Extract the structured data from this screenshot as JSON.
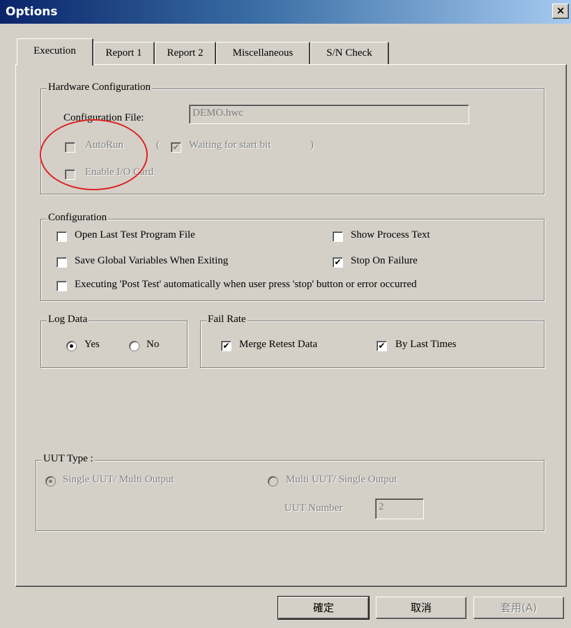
{
  "window": {
    "title": "Options",
    "close_label": "×"
  },
  "tabs": [
    {
      "label": "Execution",
      "active": true
    },
    {
      "label": "Report 1"
    },
    {
      "label": "Report 2"
    },
    {
      "label": "Miscellaneous"
    },
    {
      "label": "S/N Check"
    }
  ],
  "hardware": {
    "legend": "Hardware Configuration",
    "config_file_label": "Configuration File:",
    "config_file_value": "DEMO.hwc",
    "autorun_label": "AutoRun",
    "autorun_checked": false,
    "paren_open": "(",
    "waiting_label": "Waiting for start bit",
    "waiting_checked": true,
    "paren_close": ")",
    "enable_io_label": "Enable I/O Card",
    "enable_io_checked": false
  },
  "configuration": {
    "legend": "Configuration",
    "open_last_label": "Open Last Test Program File",
    "show_process_label": "Show Process Text",
    "save_global_label": "Save Global Variables When Exiting",
    "stop_on_failure_label": "Stop On Failure",
    "post_test_label": "Executing 'Post Test' automatically when user press 'stop' button or error occurred",
    "check_mark": "✔"
  },
  "log_data": {
    "legend": "Log Data",
    "yes_label": "Yes",
    "no_label": "No",
    "selected": "Yes"
  },
  "fail_rate": {
    "legend": "Fail Rate",
    "merge_label": "Merge Retest Data",
    "by_last_label": "By Last Times"
  },
  "uut_type": {
    "legend": "UUT Type :",
    "single_label": "Single UUT/ Multi Output",
    "multi_label": "Multi UUT/ Single Output",
    "selected": "Single UUT/ Multi Output",
    "number_label": "UUT Number",
    "number_value": "2"
  },
  "buttons": {
    "ok": "確定",
    "cancel": "取消",
    "apply": "套用(A)"
  },
  "colors": {
    "dialog_bg": "#d4d0c8",
    "title_start": "#0a246a",
    "title_end": "#a6caf0",
    "annotation": "#dd2222"
  }
}
